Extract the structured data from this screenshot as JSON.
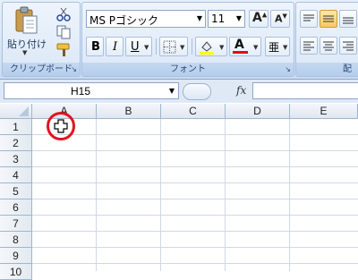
{
  "ribbon": {
    "clipboard": {
      "paste_label": "貼り付け",
      "group_label": "クリップボード"
    },
    "font": {
      "font_name": "MS Pゴシック",
      "font_size": "11",
      "group_label": "フォント",
      "bold": "B",
      "italic": "I",
      "underline": "U",
      "font_color_letter": "A"
    },
    "alignment": {
      "group_label_partial": "配"
    }
  },
  "formula_bar": {
    "name_box": "H15",
    "fx_label": "fx",
    "formula": ""
  },
  "sheet": {
    "columns": [
      "A",
      "B",
      "C",
      "D",
      "E"
    ],
    "rows": [
      "1",
      "2",
      "3",
      "4",
      "5",
      "6",
      "7",
      "8",
      "9",
      "10"
    ]
  },
  "colors": {
    "highlight_circle": "#e0141e",
    "font_color_bar": "#e01010",
    "fill_color_bar": "#ffff00"
  },
  "icons": {
    "cursor": "cell-select-cross"
  }
}
